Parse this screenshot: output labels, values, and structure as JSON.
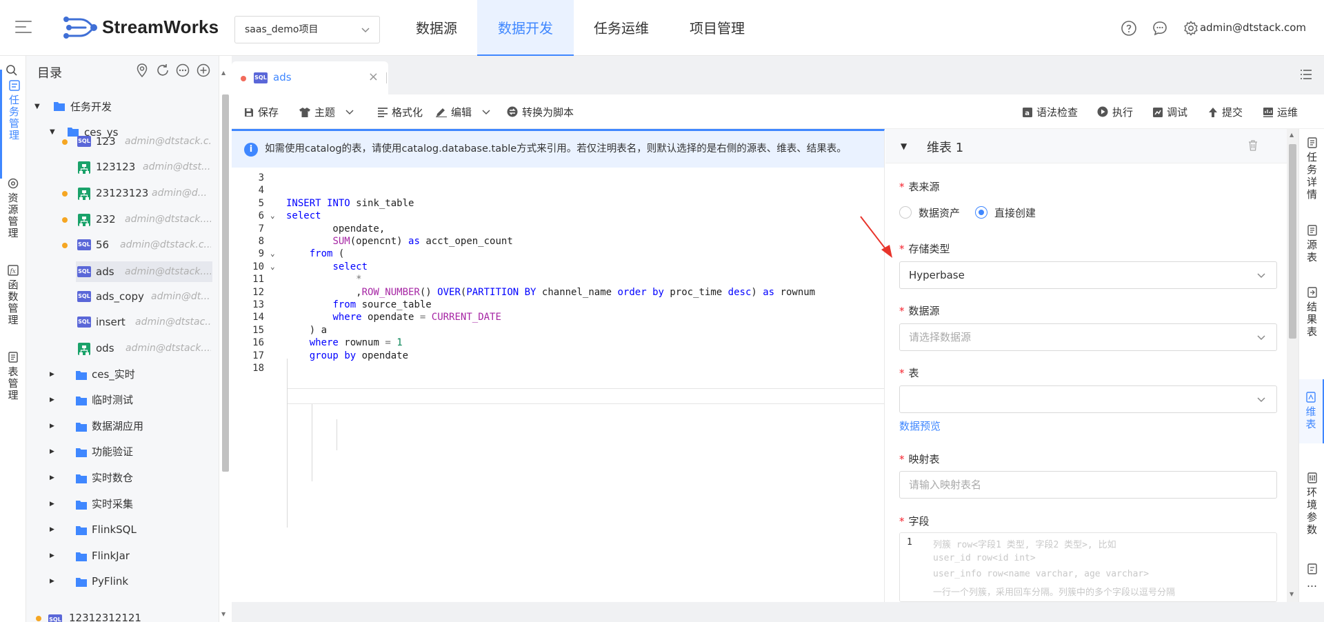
{
  "header": {
    "brand": "StreamWorks",
    "project": "saas_demo项目",
    "nav": [
      "数据源",
      "数据开发",
      "任务运维",
      "项目管理"
    ],
    "active_nav": "数据开发",
    "user": "admin@dtstack.com",
    "icons": [
      "help-icon",
      "message-icon",
      "settings-icon"
    ]
  },
  "iconbar": {
    "items": [
      {
        "label": "任务管理",
        "icon": "task-icon",
        "active": true
      },
      {
        "label": "资源管理",
        "icon": "resource-icon",
        "active": false
      },
      {
        "label": "函数管理",
        "icon": "function-icon",
        "active": false
      },
      {
        "label": "表管理",
        "icon": "table-icon",
        "active": false
      }
    ]
  },
  "tree": {
    "title": "目录",
    "root": "任务开发",
    "folder": "ces_ys",
    "files": [
      {
        "name": "123",
        "owner": "admin@dtstack.c...",
        "type": "sql",
        "dot": true
      },
      {
        "name": "123123",
        "owner": "admin@dtst...",
        "type": "flow",
        "dot": false
      },
      {
        "name": "23123123",
        "owner": "admin@d...",
        "type": "flow",
        "dot": true
      },
      {
        "name": "232",
        "owner": "admin@dtstack....",
        "type": "flow",
        "dot": true
      },
      {
        "name": "56",
        "owner": "admin@dtstack.c...",
        "type": "sql",
        "dot": true
      },
      {
        "name": "ads",
        "owner": "admin@dtstack....",
        "type": "sql",
        "dot": false
      },
      {
        "name": "ads_copy",
        "owner": "admin@dt...",
        "type": "sql",
        "dot": false
      },
      {
        "name": "insert",
        "owner": "admin@dtstac...",
        "type": "sql",
        "dot": false
      },
      {
        "name": "ods",
        "owner": "admin@dtstack....",
        "type": "flow",
        "dot": false
      }
    ],
    "folders": [
      "ces_实时",
      "临时测试",
      "数据湖应用",
      "功能验证",
      "实时数仓",
      "实时采集",
      "FlinkSQL",
      "FlinkJar",
      "PyFlink"
    ],
    "partial_row": "12312312121"
  },
  "tab": {
    "label": "ads"
  },
  "toolbar": {
    "left": [
      "保存",
      "主题",
      "格式化",
      "编辑",
      "转换为脚本"
    ],
    "right": [
      "语法检查",
      "执行",
      "调试",
      "提交",
      "运维"
    ]
  },
  "notice": "如需使用catalog的表，请使用catalog.database.table方式来引用。若仅注明表名，则默认选择的是右侧的源表、维表、结果表。",
  "code_lines": [
    {
      "n": "3",
      "t": ""
    },
    {
      "n": "4",
      "t": ""
    },
    {
      "n": "5",
      "t": "INSERT INTO sink_table"
    },
    {
      "n": "6",
      "t": "select"
    },
    {
      "n": "7",
      "t": "        opendate,"
    },
    {
      "n": "8",
      "t": "        SUM(opencnt) as acct_open_count"
    },
    {
      "n": "9",
      "t": "    from ("
    },
    {
      "n": "10",
      "t": "        select"
    },
    {
      "n": "11",
      "t": "            *"
    },
    {
      "n": "12",
      "t": "            ,ROW_NUMBER() OVER(PARTITION BY channel_name order by proc_time desc) as rownum"
    },
    {
      "n": "13",
      "t": "        from source_table"
    },
    {
      "n": "14",
      "t": "        where opendate = CURRENT_DATE"
    },
    {
      "n": "15",
      "t": "    ) a"
    },
    {
      "n": "16",
      "t": "    where rownum = 1"
    },
    {
      "n": "17",
      "t": "    group by opendate"
    },
    {
      "n": "18",
      "t": ""
    }
  ],
  "panel": {
    "title": "维表 1",
    "source_label": "表来源",
    "source_options": [
      "数据资产",
      "直接创建"
    ],
    "source_selected": "直接创建",
    "storage_label": "存储类型",
    "storage_value": "Hyperbase",
    "datasource_label": "数据源",
    "datasource_placeholder": "请选择数据源",
    "table_label": "表",
    "table_value": "",
    "preview_link": "数据预览",
    "mapping_label": "映射表",
    "mapping_placeholder": "请输入映射表名",
    "fields_label": "字段",
    "fields_line_no": "1",
    "fields_placeholder": [
      "列簇 row<字段1 类型, 字段2 类型>, 比如",
      "user_id row<id int>",
      "user_info row<name varchar, age varchar>",
      "一行一个列簇，采用回车分隔。列簇中的多个字段以逗号分隔"
    ]
  },
  "rtabs": [
    {
      "label": "任务详情",
      "icon": "detail-icon",
      "active": false
    },
    {
      "label": "源表",
      "icon": "source-table-icon",
      "active": false
    },
    {
      "label": "结果表",
      "icon": "result-table-icon",
      "active": false
    },
    {
      "label": "维表",
      "icon": "dim-table-icon",
      "active": true
    },
    {
      "label": "环境参数",
      "icon": "env-param-icon",
      "active": false
    },
    {
      "label": "…",
      "icon": "more-icon",
      "active": false
    }
  ]
}
